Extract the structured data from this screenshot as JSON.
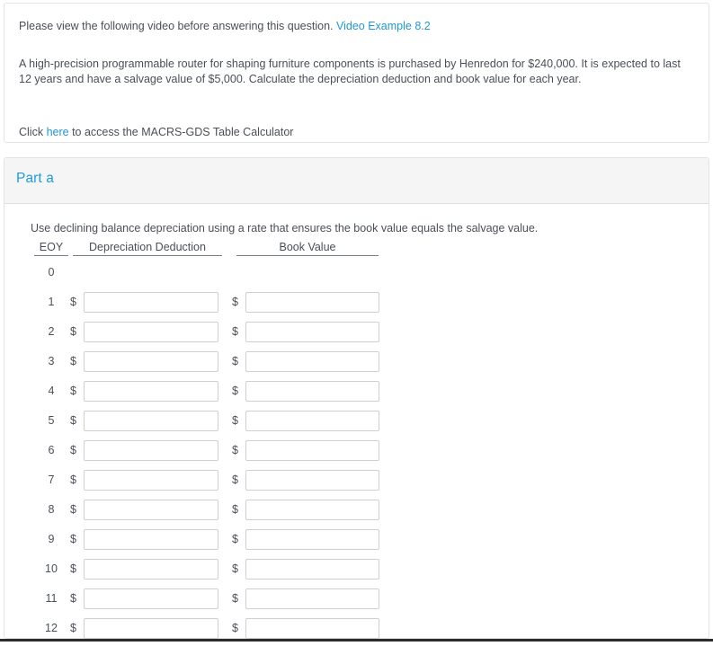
{
  "question": {
    "intro_prefix": "Please view the following video before answering this question. ",
    "video_link": "Video Example 8.2",
    "problem_text": "A high-precision programmable router for shaping furniture components is purchased by Henredon for $240,000. It is expected to last 12 years and have a salvage value of $5,000. Calculate the depreciation deduction and book value for each year.",
    "calculator_prefix": "Click ",
    "calculator_link": "here",
    "calculator_suffix": " to access the MACRS-GDS Table Calculator"
  },
  "part": {
    "title": "Part a",
    "instruction": "Use declining balance depreciation using a rate that ensures the book value equals the salvage value.",
    "table": {
      "headers": {
        "eoy": "EOY",
        "depreciation": "Depreciation Deduction",
        "book_value": "Book Value"
      },
      "currency_symbol": "$",
      "rows": [
        {
          "eoy": "0",
          "has_inputs": false,
          "depreciation": "",
          "book_value": ""
        },
        {
          "eoy": "1",
          "has_inputs": true,
          "depreciation": "",
          "book_value": ""
        },
        {
          "eoy": "2",
          "has_inputs": true,
          "depreciation": "",
          "book_value": ""
        },
        {
          "eoy": "3",
          "has_inputs": true,
          "depreciation": "",
          "book_value": ""
        },
        {
          "eoy": "4",
          "has_inputs": true,
          "depreciation": "",
          "book_value": ""
        },
        {
          "eoy": "5",
          "has_inputs": true,
          "depreciation": "",
          "book_value": ""
        },
        {
          "eoy": "6",
          "has_inputs": true,
          "depreciation": "",
          "book_value": ""
        },
        {
          "eoy": "7",
          "has_inputs": true,
          "depreciation": "",
          "book_value": ""
        },
        {
          "eoy": "8",
          "has_inputs": true,
          "depreciation": "",
          "book_value": ""
        },
        {
          "eoy": "9",
          "has_inputs": true,
          "depreciation": "",
          "book_value": ""
        },
        {
          "eoy": "10",
          "has_inputs": true,
          "depreciation": "",
          "book_value": ""
        },
        {
          "eoy": "11",
          "has_inputs": true,
          "depreciation": "",
          "book_value": ""
        },
        {
          "eoy": "12",
          "has_inputs": true,
          "depreciation": "",
          "book_value": ""
        }
      ]
    }
  },
  "colors": {
    "link": "#2196d6",
    "part_title": "#1b9ddb",
    "text": "#4a4f57",
    "header_bg": "#f5f5f5",
    "card_border": "#e3e3e3",
    "input_border": "#cfcfcf"
  }
}
